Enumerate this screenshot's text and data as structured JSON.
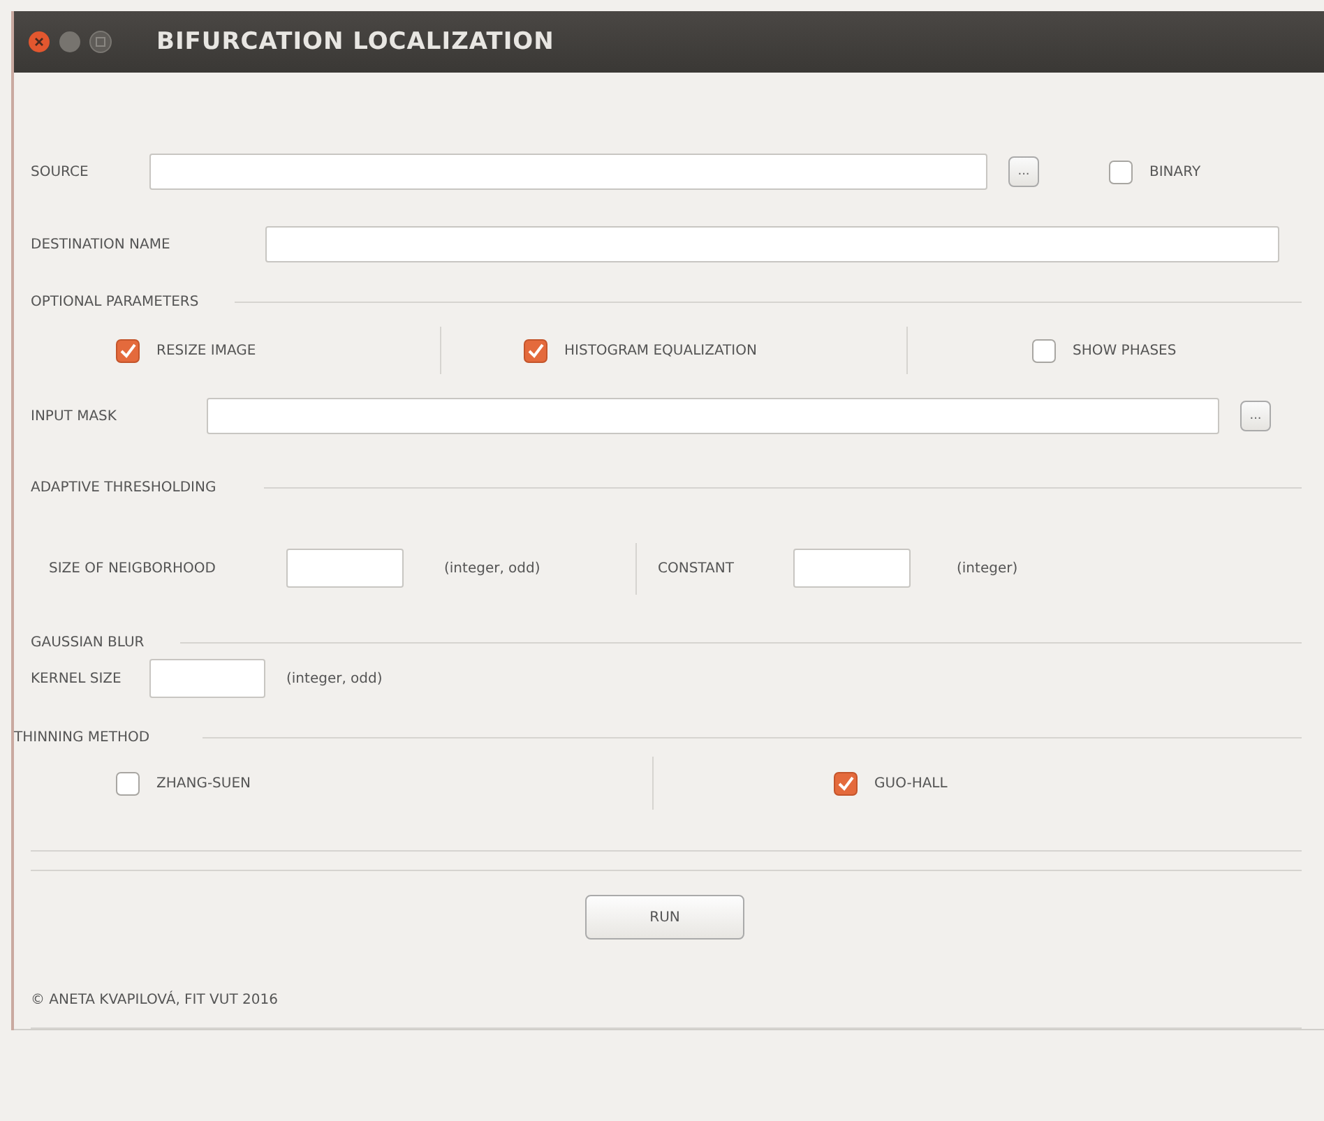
{
  "window": {
    "title": "BIFURCATION LOCALIZATION"
  },
  "source": {
    "label": "SOURCE",
    "browse_button": "...",
    "binary": {
      "label": "BINARY",
      "checked": false
    }
  },
  "destination": {
    "label": "DESTINATION NAME"
  },
  "optional_parameters": {
    "title": "OPTIONAL PARAMETERS",
    "options": [
      {
        "label": "RESIZE IMAGE",
        "checked": true
      },
      {
        "label": "HISTOGRAM EQUALIZATION",
        "checked": true
      },
      {
        "label": "SHOW PHASES",
        "checked": false
      }
    ]
  },
  "input_mask": {
    "label": "INPUT MASK",
    "browse_button": "..."
  },
  "adaptive_thresholding": {
    "title": "ADAPTIVE THRESHOLDING",
    "fields": [
      {
        "label": "SIZE OF NEIGBORHOOD",
        "hint": "(integer, odd)"
      },
      {
        "label": "CONSTANT",
        "hint": "(integer)"
      }
    ]
  },
  "gaussian_blur": {
    "title": "GAUSSIAN BLUR",
    "field": {
      "label": "KERNEL SIZE",
      "hint": "(integer, odd)"
    }
  },
  "thinning_method": {
    "title": "THINNING METHOD",
    "options": [
      {
        "label": "ZHANG-SUEN",
        "checked": false
      },
      {
        "label": "GUO-HALL",
        "checked": true
      }
    ]
  },
  "run_button": "RUN",
  "copyright": "© ANETA KVAPILOVÁ, FIT VUT 2016"
}
